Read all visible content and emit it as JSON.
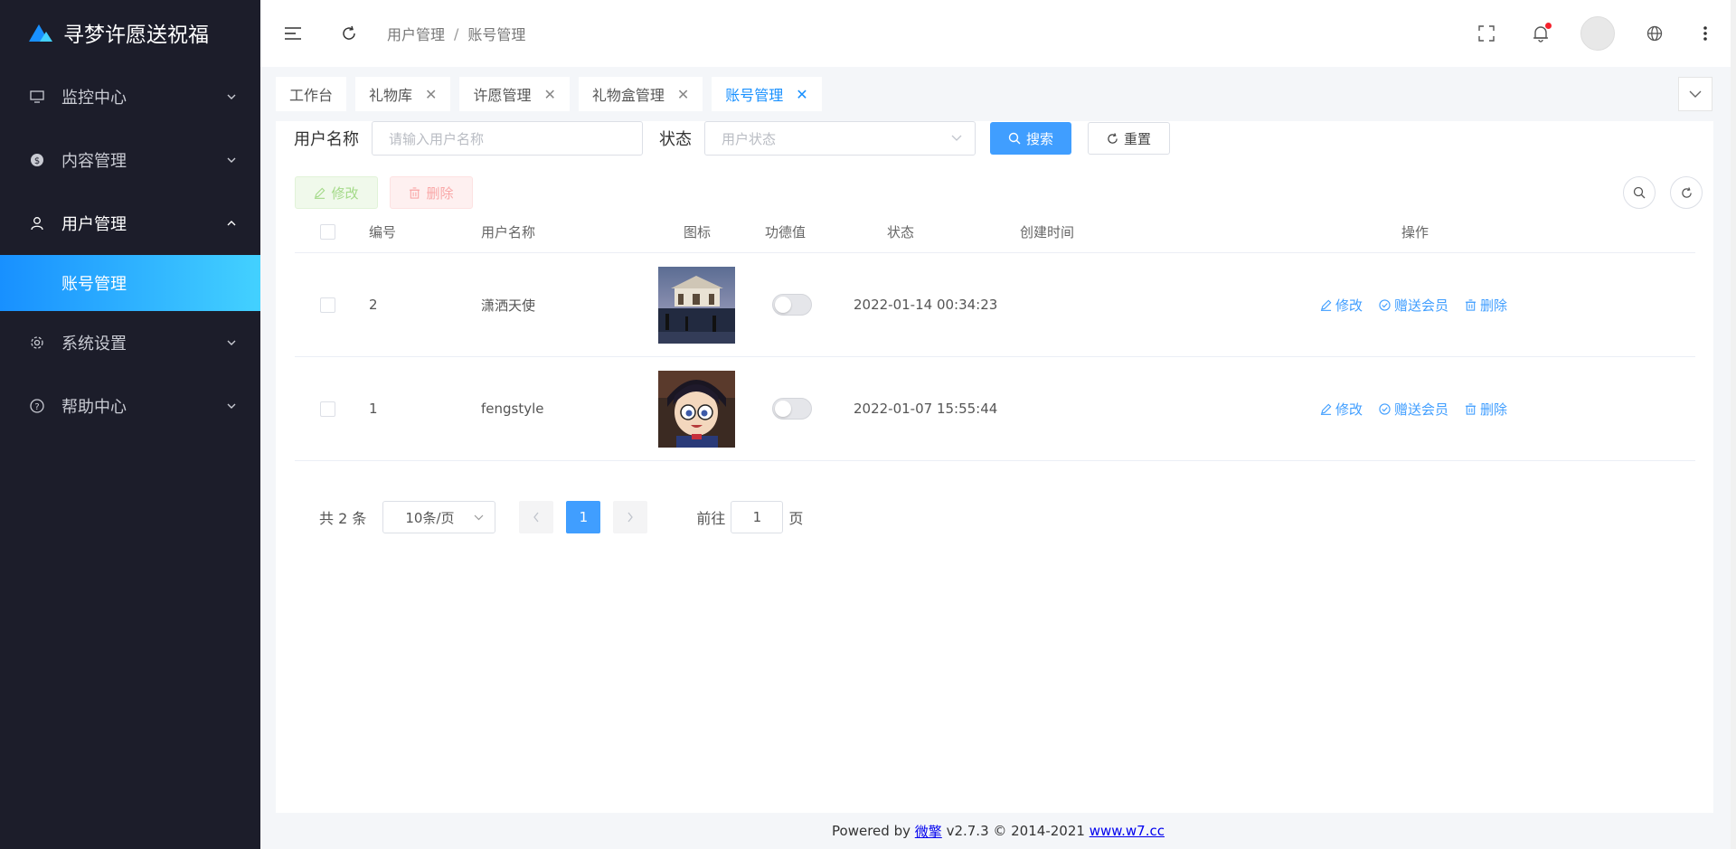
{
  "app": {
    "title": "寻梦许愿送祝福"
  },
  "sidebar": {
    "items": [
      {
        "label": "监控中心",
        "icon": "monitor-icon"
      },
      {
        "label": "内容管理",
        "icon": "dollar-circle-icon"
      },
      {
        "label": "用户管理",
        "icon": "user-icon"
      },
      {
        "label": "系统设置",
        "icon": "gear-icon"
      },
      {
        "label": "帮助中心",
        "icon": "question-circle-icon"
      }
    ],
    "active_sub": "账号管理"
  },
  "header": {
    "breadcrumb": [
      "用户管理",
      "账号管理"
    ],
    "separator": "/"
  },
  "tabs": [
    {
      "label": "工作台",
      "closable": false
    },
    {
      "label": "礼物库",
      "closable": true
    },
    {
      "label": "许愿管理",
      "closable": true
    },
    {
      "label": "礼物盒管理",
      "closable": true
    },
    {
      "label": "账号管理",
      "closable": true,
      "active": true
    }
  ],
  "search": {
    "username_label": "用户名称",
    "username_placeholder": "请输入用户名称",
    "status_label": "状态",
    "status_placeholder": "用户状态",
    "search_button": "搜索",
    "reset_button": "重置"
  },
  "toolbar": {
    "edit_label": "修改",
    "delete_label": "删除"
  },
  "table": {
    "columns": [
      "编号",
      "用户名称",
      "图标",
      "功德值",
      "状态",
      "创建时间",
      "操作"
    ],
    "rows": [
      {
        "id": "2",
        "name": "潇洒天使",
        "merit": "",
        "status": false,
        "created": "2022-01-14 00:34:23"
      },
      {
        "id": "1",
        "name": "fengstyle",
        "merit": "",
        "status": false,
        "created": "2022-01-07 15:55:44"
      }
    ],
    "ops": {
      "edit": "修改",
      "gift": "赠送会员",
      "delete": "删除"
    }
  },
  "pagination": {
    "total": "共 2 条",
    "page_size": "10条/页",
    "current": "1",
    "goto_label": "前往",
    "goto_value": "1",
    "page_suffix": "页"
  },
  "footer": {
    "powered": "Powered by",
    "brand": "微擎",
    "version": "v2.7.3 © 2014-2021",
    "site": "www.w7.cc"
  },
  "colors": {
    "primary": "#409eff",
    "sidebar": "#1c1d2a",
    "accent_gradient_start": "#1890ff",
    "accent_gradient_end": "#43d1ff"
  }
}
